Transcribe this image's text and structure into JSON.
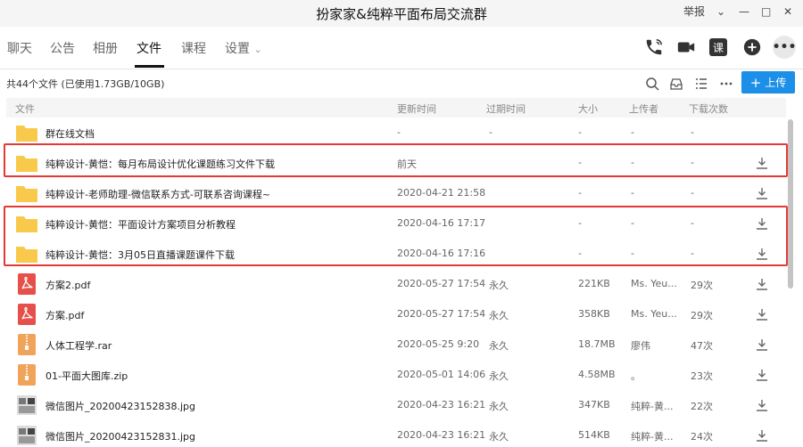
{
  "window": {
    "title": "扮家家&纯粹平面布局交流群",
    "report_label": "举报",
    "controls": [
      "⌄",
      "—",
      "□",
      "✕"
    ]
  },
  "nav": {
    "tabs": [
      "聊天",
      "公告",
      "相册",
      "文件",
      "课程",
      "设置"
    ],
    "active_tab": "文件",
    "settings_chevron": "⌄",
    "course_button_label": "课",
    "more_label": "•••"
  },
  "summary": "共44个文件 (已使用1.73GB/10GB)",
  "upload_button": {
    "plus": "+",
    "label": "上传"
  },
  "table": {
    "headers": [
      "文件",
      "更新时间",
      "过期时间",
      "大小",
      "上传者",
      "下载次数"
    ],
    "rows": [
      {
        "icon": "folder-icon",
        "name": "群在线文档",
        "updated": "-",
        "expires": "-",
        "size": "-",
        "uploader": "-",
        "downloads": "-",
        "download": false
      },
      {
        "icon": "folder-icon",
        "name": "纯粹设计-黄恺：每月布局设计优化课题练习文件下载",
        "updated": "前天",
        "expires": "",
        "size": "-",
        "uploader": "-",
        "downloads": "-",
        "download": true
      },
      {
        "icon": "folder-icon",
        "name": "纯粹设计-老师助理-微信联系方式-可联系咨询课程~",
        "updated": "2020-04-21 21:58",
        "expires": "",
        "size": "-",
        "uploader": "-",
        "downloads": "-",
        "download": true
      },
      {
        "icon": "folder-icon",
        "name": "纯粹设计-黄恺：平面设计方案项目分析教程",
        "updated": "2020-04-16 17:17",
        "expires": "",
        "size": "-",
        "uploader": "-",
        "downloads": "-",
        "download": true
      },
      {
        "icon": "folder-icon",
        "name": "纯粹设计-黄恺：3月05日直播课题课件下载",
        "updated": "2020-04-16 17:16",
        "expires": "",
        "size": "-",
        "uploader": "-",
        "downloads": "-",
        "download": true
      },
      {
        "icon": "pdf-icon",
        "name": "方案2.pdf",
        "updated": "2020-05-27 17:54",
        "expires": "永久",
        "size": "221KB",
        "uploader": "Ms. Yeu...",
        "downloads": "29次",
        "download": true
      },
      {
        "icon": "pdf-icon",
        "name": "方案.pdf",
        "updated": "2020-05-27 17:54",
        "expires": "永久",
        "size": "358KB",
        "uploader": "Ms. Yeu...",
        "downloads": "29次",
        "download": true
      },
      {
        "icon": "archive-icon",
        "name": "人体工程学.rar",
        "updated": "2020-05-25 9:20",
        "expires": "永久",
        "size": "18.7MB",
        "uploader": "廖伟",
        "downloads": "47次",
        "download": true
      },
      {
        "icon": "archive-icon",
        "name": "01-平面大图库.zip",
        "updated": "2020-05-01 14:06",
        "expires": "永久",
        "size": "4.58MB",
        "uploader": "。",
        "downloads": "23次",
        "download": true
      },
      {
        "icon": "image-icon",
        "name": "微信图片_20200423152838.jpg",
        "updated": "2020-04-23 16:21",
        "expires": "永久",
        "size": "347KB",
        "uploader": "纯粹-黄...",
        "downloads": "22次",
        "download": true
      },
      {
        "icon": "image-icon",
        "name": "微信图片_20200423152831.jpg",
        "updated": "2020-04-23 16:21",
        "expires": "永久",
        "size": "514KB",
        "uploader": "纯粹-黄...",
        "downloads": "24次",
        "download": true
      }
    ]
  },
  "colors": {
    "accent": "#1c8fe8",
    "highlight": "#e53935",
    "folder": "#f9c94c",
    "pdf": "#e5504a",
    "archive": "#f0a35a"
  }
}
